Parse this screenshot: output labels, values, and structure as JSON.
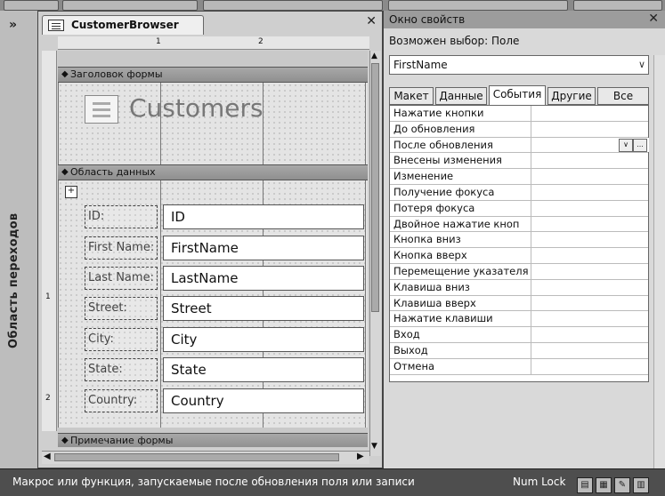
{
  "navigation_pane": {
    "toggle_glyph": "»",
    "label": "Область переходов"
  },
  "document": {
    "tab_title": "CustomerBrowser",
    "close_glyph": "✕",
    "ruler_h": [
      "1",
      "2"
    ],
    "ruler_v": [
      "1",
      "2"
    ],
    "sections": {
      "header": "Заголовок формы",
      "detail": "Область данных",
      "footer": "Примечание формы"
    },
    "header_title": "Customers",
    "fields": [
      {
        "label": "ID:",
        "control": "ID"
      },
      {
        "label": "First Name:",
        "control": "FirstName"
      },
      {
        "label": "Last Name:",
        "control": "LastName"
      },
      {
        "label": "Street:",
        "control": "Street"
      },
      {
        "label": "City:",
        "control": "City"
      },
      {
        "label": "State:",
        "control": "State"
      },
      {
        "label": "Country:",
        "control": "Country"
      }
    ]
  },
  "property_sheet": {
    "title": "Окно свойств",
    "close_glyph": "✕",
    "selection_label": "Возможен выбор:  Поле",
    "selected_object": "FirstName",
    "tabs": [
      {
        "label": "Макет",
        "active": false
      },
      {
        "label": "Данные",
        "active": false
      },
      {
        "label": "События",
        "active": true
      },
      {
        "label": "Другие",
        "active": false
      },
      {
        "label": "Все",
        "active": false
      }
    ],
    "events": [
      "Нажатие кнопки",
      "До обновления",
      "После обновления",
      "Внесены изменения",
      "Изменение",
      "Получение фокуса",
      "Потеря фокуса",
      "Двойное нажатие кноп",
      "Кнопка вниз",
      "Кнопка вверх",
      "Перемещение указателя",
      "Клавиша вниз",
      "Клавиша вверх",
      "Нажатие клавиши",
      "Вход",
      "Выход",
      "Отмена"
    ],
    "selected_event_index": 2,
    "builder_glyph": "...",
    "dropdown_glyph": "∨"
  },
  "status_bar": {
    "text": "Макрос или функция, запускаемые после обновления поля или записи",
    "numlock": "Num Lock"
  },
  "colors": {
    "accent_gray": "#9c9c9c",
    "status_bg": "#4e4e4e"
  }
}
